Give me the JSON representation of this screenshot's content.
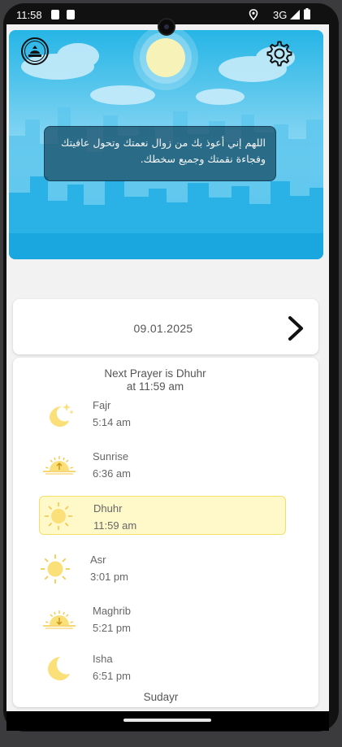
{
  "status_bar": {
    "time": "11:58",
    "network": "3G"
  },
  "header": {
    "dua_text": "اللهم إني أعوذ بك من زوال نعمتك وتحول عافيتك وفجاءة نقمتك وجميع سخطك.",
    "logo_icon": "mosque-logo-icon",
    "settings_icon": "gear-icon"
  },
  "date_nav": {
    "date": "09.01.2025",
    "next_icon": "chevron-right-icon"
  },
  "prayers": {
    "next_line1": "Next Prayer is Dhuhr",
    "next_line2": "at 11:59 am",
    "items": [
      {
        "name": "Fajr",
        "time": "5:14 am",
        "icon": "moon-stars-icon"
      },
      {
        "name": "Sunrise",
        "time": "6:36 am",
        "icon": "sunrise-icon"
      },
      {
        "name": "Dhuhr",
        "time": "11:59 am",
        "icon": "sun-icon"
      },
      {
        "name": "Asr",
        "time": "3:01 pm",
        "icon": "sun-icon"
      },
      {
        "name": "Maghrib",
        "time": "5:21 pm",
        "icon": "sunset-icon"
      },
      {
        "name": "Isha",
        "time": "6:51 pm",
        "icon": "moon-icon"
      }
    ],
    "active_color": "#fff8c9",
    "icon_color": "#fbe07a",
    "location": "Sudayr"
  }
}
